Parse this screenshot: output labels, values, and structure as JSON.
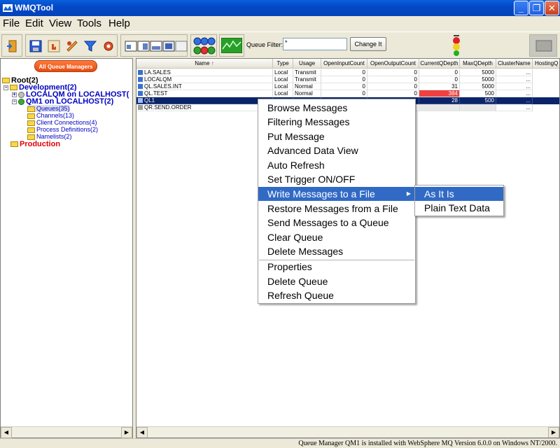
{
  "window": {
    "title": "WMQTool"
  },
  "menu": [
    "File",
    "Edit",
    "View",
    "Tools",
    "Help"
  ],
  "toolbar": {
    "filter_label": "Queue Filter:",
    "filter_value": "*",
    "change_label": "Change It"
  },
  "tree": {
    "all_qm_button": "All Queue Managers",
    "root": "Root(2)",
    "development": "Development(2)",
    "localqm": "LOCALQM on LOCALHOST(",
    "qm1": "QM1 on LOCALHOST(2)",
    "queues": "Queues(35)",
    "channels": "Channels(13)",
    "client_connections": "Client Connections(4)",
    "process_definitions": "Process Definitions(2)",
    "namelists": "Namelists(2)",
    "production": "Production"
  },
  "grid": {
    "columns": [
      "Name",
      "Type",
      "Usage",
      "OpenInputCount",
      "OpenOutputCount",
      "CurrentQDepth",
      "MaxQDepth",
      "ClusterName",
      "HostingQ"
    ],
    "rows": [
      {
        "name": "LA.SALES",
        "type": "Local",
        "usage": "Transmit",
        "open_in": "0",
        "open_out": "0",
        "depth": "0",
        "max": "5000",
        "cluster": "..."
      },
      {
        "name": "LOCALQM",
        "type": "Local",
        "usage": "Transmit",
        "open_in": "0",
        "open_out": "0",
        "depth": "0",
        "max": "5000",
        "cluster": "..."
      },
      {
        "name": "QL.SALES.INT",
        "type": "Local",
        "usage": "Normal",
        "open_in": "0",
        "open_out": "0",
        "depth": "31",
        "max": "5000",
        "cluster": "..."
      },
      {
        "name": "QL.TEST",
        "type": "Local",
        "usage": "Normal",
        "open_in": "0",
        "open_out": "0",
        "depth": "384",
        "max": "500",
        "cluster": "..."
      },
      {
        "name": "QL1",
        "type": "",
        "usage": "",
        "open_in": "",
        "open_out": "",
        "depth": "28",
        "max": "500",
        "cluster": "..."
      },
      {
        "name": "QR.SEND.ORDER",
        "type": "",
        "usage": "",
        "open_in": "",
        "open_out": "",
        "depth": "",
        "max": "",
        "cluster": "..."
      }
    ]
  },
  "context_menu": {
    "items": [
      "Browse Messages",
      "Filtering Messages",
      "Put Message",
      "Advanced Data View",
      "Auto Refresh",
      "Set Trigger ON/OFF",
      "Write Messages to a File",
      "Restore Messages from a File",
      "Send Messages to a Queue",
      "Clear Queue",
      "Delete Messages",
      "Properties",
      "Delete Queue",
      "Refresh Queue"
    ],
    "submenu": [
      "As It Is",
      "Plain Text Data"
    ]
  },
  "status": "Queue Manager QM1 is installed with WebSphere MQ Version 6.0.0 on Windows NT/2000.",
  "colors": {
    "title": "#0449c8",
    "selection": "#0a246a",
    "menu_highlight": "#316ac5",
    "alert": "#f04040"
  }
}
